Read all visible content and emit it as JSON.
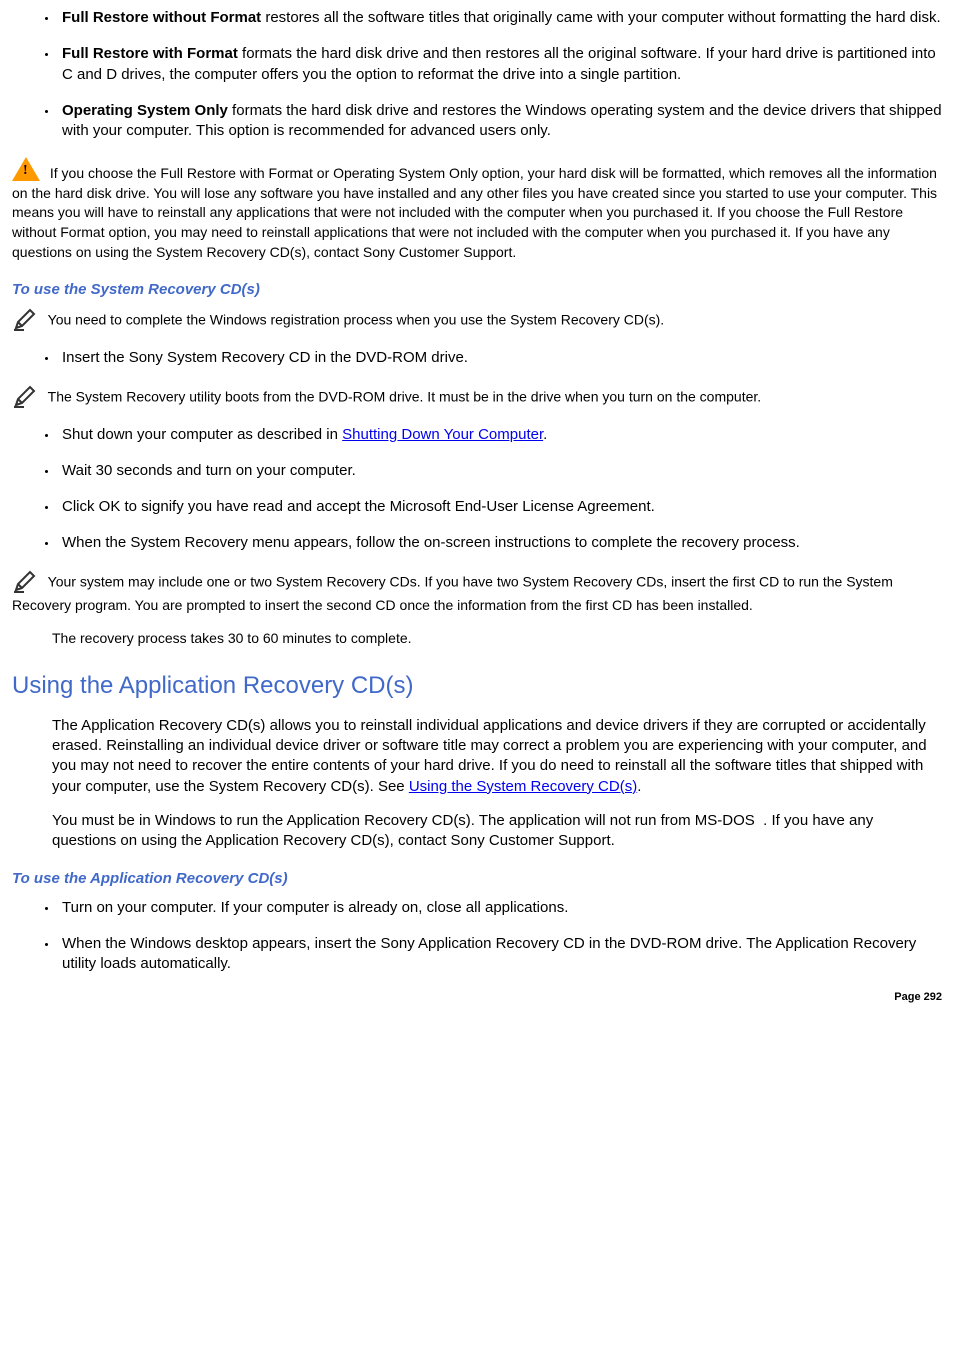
{
  "options": [
    {
      "title": "Full Restore without Format",
      "text": " restores all the software titles that originally came with your computer without formatting the hard disk."
    },
    {
      "title": "Full Restore with Format",
      "text": " formats the hard disk drive and then restores all the original software. If your hard drive is partitioned into C and D drives, the computer offers you the option to reformat the drive into a single partition."
    },
    {
      "title": "Operating System Only",
      "text": " formats the hard disk drive and restores the Windows operating system and the device drivers that shipped with your computer. This option is recommended for advanced users only."
    }
  ],
  "warning_text": " If you choose the Full Restore with Format or Operating System Only option, your hard disk will be formatted, which removes all the information on the hard disk drive. You will lose any software you have installed and any other files you have created since you started to use your computer. This means you will have to reinstall any applications that were not included with the computer when you purchased it. If you choose the Full Restore without Format option, you may need to reinstall applications that were not included with the computer when you purchased it. If you have any questions on using the System Recovery CD(s), contact Sony Customer Support.",
  "subhead1": "To use the System Recovery CD(s)",
  "note1": " You need to complete the Windows registration process when you use the System Recovery CD(s).",
  "step_insert": "Insert the Sony System Recovery CD in the DVD-ROM drive.",
  "note2": " The System Recovery utility boots from the DVD-ROM drive. It must be in the drive when you turn on the computer.",
  "steps2": {
    "a_pre": "Shut down your computer as described in ",
    "a_link": "Shutting Down Your Computer",
    "a_post": ".",
    "b": "Wait 30 seconds and turn on your computer.",
    "c": "Click OK to signify you have read and accept the Microsoft End-User License Agreement.",
    "d": "When the System Recovery menu appears, follow the on-screen instructions to complete the recovery process."
  },
  "note3": " Your system may include one or two System Recovery CDs. If you have two System Recovery CDs, insert the first CD to run the System Recovery program. You are prompted to insert the second CD once the information from the first CD has been installed.",
  "time_note": "The recovery process takes 30 to 60 minutes to complete.",
  "h2": "Using the Application Recovery CD(s)",
  "app_para1_pre": "The Application Recovery CD(s) allows you to reinstall individual applications and device drivers if they are corrupted or accidentally erased. Reinstalling an individual device driver or software title may correct a problem you are experiencing with your computer, and you may not need to recover the entire contents of your hard drive. If you do need to reinstall all the software titles that shipped with your computer, use the System Recovery CD(s). See ",
  "app_para1_link": "Using the System Recovery CD(s)",
  "app_para1_post": ".",
  "app_para2": "You must be in Windows to run the Application Recovery CD(s). The application will not run from MS-DOS  . If you have any questions on using the Application Recovery CD(s), contact Sony Customer Support.",
  "subhead2": "To use the Application Recovery CD(s)",
  "app_steps": [
    "Turn on your computer. If your computer is already on, close all applications.",
    "When the Windows desktop appears, insert the Sony Application Recovery CD in the DVD-ROM drive. The Application Recovery utility loads automatically."
  ],
  "page_label": "Page 292"
}
